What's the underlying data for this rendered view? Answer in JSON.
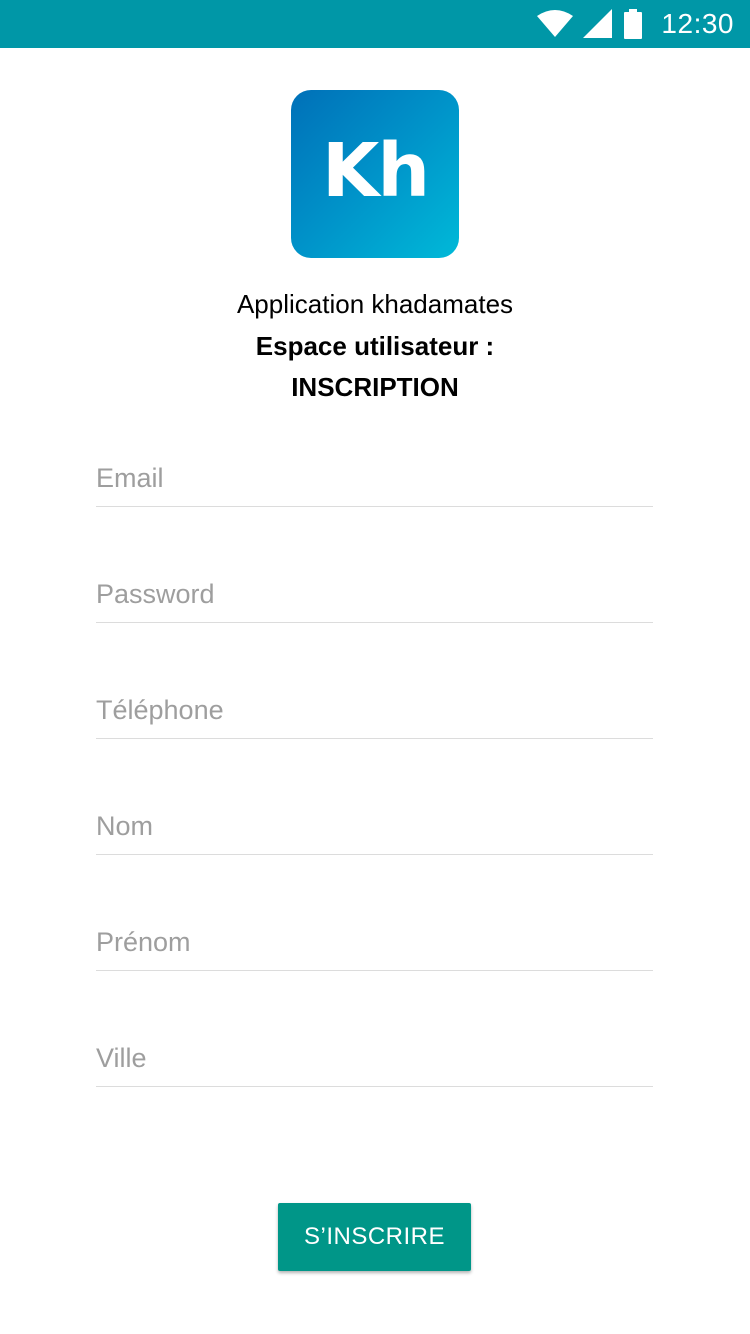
{
  "status_bar": {
    "time": "12:30",
    "color": "#0097a7",
    "icons": [
      "wifi-icon",
      "signal-icon",
      "battery-icon"
    ]
  },
  "logo": {
    "text": "Kh",
    "gradient": [
      "#0070b8",
      "#00b9d8"
    ]
  },
  "header": {
    "app_name": "Application khadamates",
    "space_label": "Espace utilisateur :",
    "title": "INSCRIPTION"
  },
  "form": {
    "email_placeholder": "Email",
    "password_placeholder": "Password",
    "phone_placeholder": "Téléphone",
    "nom_placeholder": "Nom",
    "prenom_placeholder": "Prénom",
    "ville_placeholder": "Ville",
    "submit_label": "S’INSCRIRE",
    "submit_color": "#009688"
  }
}
